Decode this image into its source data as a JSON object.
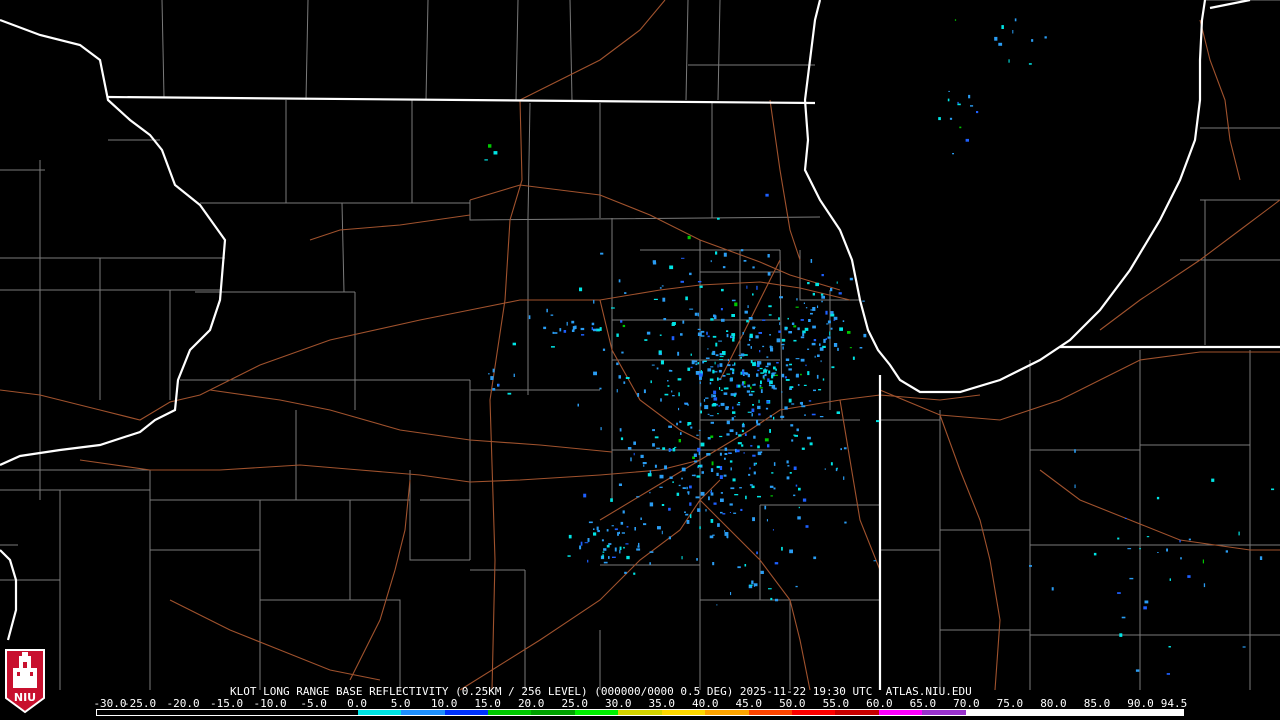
{
  "product_title": "KLOT LONG RANGE BASE REFLECTIVITY (0.25KM / 256 LEVEL) (000000/0000 0.5 DEG) 2025-11-22 19:30 UTC  ATLAS.NIU.EDU",
  "color_scale": {
    "labels": [
      "-30.0",
      "-25.0",
      "-20.0",
      "-15.0",
      "-10.0",
      "-5.0",
      "0.0",
      "5.0",
      "10.0",
      "15.0",
      "20.0",
      "25.0",
      "30.0",
      "35.0",
      "40.0",
      "45.0",
      "50.0",
      "55.0",
      "60.0",
      "65.0",
      "70.0",
      "75.0",
      "80.0",
      "85.0",
      "90.0",
      "94.5"
    ],
    "colors": [
      "#000000",
      "#000000",
      "#000000",
      "#000000",
      "#000000",
      "#000000",
      "#00e5e5",
      "#1e90ff",
      "#0033ff",
      "#00c800",
      "#00a000",
      "#00f000",
      "#d4d400",
      "#ffd800",
      "#ffa500",
      "#ff4500",
      "#ff0000",
      "#c80000",
      "#ff00ff",
      "#9933cc",
      "#ffffff",
      "#ffffff",
      "#ffffff",
      "#ffffff",
      "#ffffff"
    ]
  },
  "logo": {
    "text": "NIU",
    "icon": "niu-tower-icon",
    "color": "#c8102e"
  },
  "map": {
    "background": "#000000",
    "state_border_color": "#ffffff",
    "county_border_color": "#7a7a7a",
    "highway_color": "#a0522d",
    "echo_colors": [
      "#2a9df4",
      "#00e5e5",
      "#1e60ff",
      "#00c800"
    ]
  }
}
